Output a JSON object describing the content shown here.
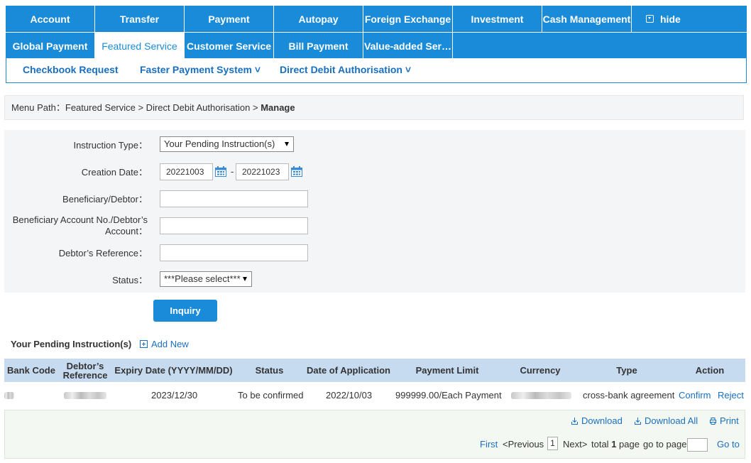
{
  "nav": {
    "row1": [
      "Account",
      "Transfer",
      "Payment",
      "Autopay",
      "Foreign Exchange",
      "Investment",
      "Cash Management"
    ],
    "hide_label": "hide",
    "row2": [
      "Global Payment",
      "Featured Service",
      "Customer Service",
      "Bill Payment",
      "Value-added Ser…"
    ],
    "active": "Featured Service",
    "colors": {
      "primary": "#1a8bd8",
      "link": "#1a6fc0"
    }
  },
  "subnav": {
    "items": [
      "Checkbook Request",
      "Faster Payment System ˅",
      "Direct Debit Authorisation ˅"
    ]
  },
  "breadcrumb": {
    "prefix": "Menu Path：Featured Service > Direct Debit Authorisation > ",
    "current": "Manage"
  },
  "form": {
    "instruction_type": {
      "label": "Instruction Type：",
      "value": "Your Pending Instruction(s)"
    },
    "creation_date": {
      "label": "Creation Date：",
      "from": "20221003",
      "separator": "-",
      "to": "20221023"
    },
    "beneficiary": {
      "label": "Beneficiary/Debtor：",
      "value": ""
    },
    "account_no": {
      "label1": "Beneficiary Account No./Debtor’s",
      "label2": "Account：",
      "value": ""
    },
    "debtor_ref": {
      "label": "Debtor’s Reference：",
      "value": ""
    },
    "status": {
      "label": "Status：",
      "value": "***Please select***"
    },
    "inquiry_label": "Inquiry"
  },
  "results": {
    "title": "Your Pending Instruction(s)",
    "add_new": "Add New",
    "columns": {
      "bank_code": "Bank Code",
      "debtor_ref1": "Debtor’s",
      "debtor_ref2": "Reference",
      "expiry": "Expiry Date (YYYY/MM/DD)",
      "status": "Status",
      "date_app": "Date of Application",
      "limit": "Payment Limit",
      "currency": "Currency",
      "type": "Type",
      "action": "Action"
    },
    "rows": [
      {
        "expiry": "2023/12/30",
        "status": "To be confirmed",
        "date_app": "2022/10/03",
        "limit": "999999.00/Each Payment",
        "type": "cross-bank agreement",
        "confirm": "Confirm",
        "reject": "Reject"
      }
    ]
  },
  "footer": {
    "download": "Download",
    "download_all": "Download All",
    "print": "Print",
    "first": "First",
    "prev": "<Previous",
    "page": "1",
    "next": "Next>",
    "total_prefix": "total ",
    "total_pages": "1",
    "total_suffix": " page",
    "goto_label": "go to page",
    "goto_btn": "Go to"
  }
}
